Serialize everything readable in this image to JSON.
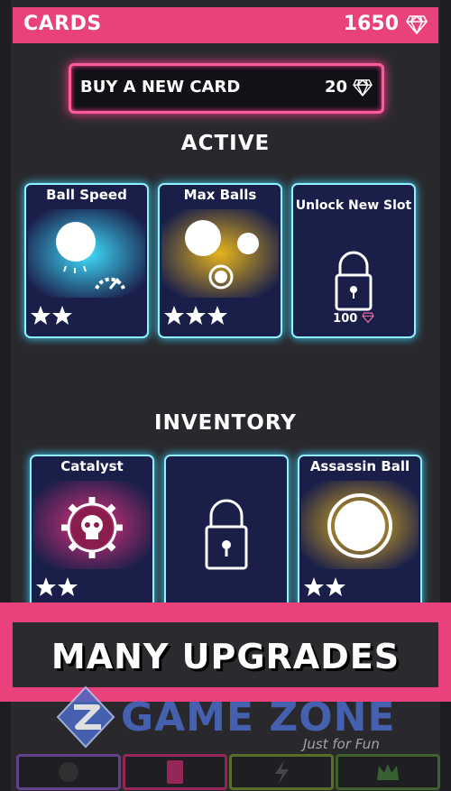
{
  "header": {
    "title": "CARDS",
    "gem_count": "1650"
  },
  "buy_button": {
    "label": "BUY A NEW CARD",
    "price": "20"
  },
  "sections": {
    "active": "ACTIVE",
    "inventory": "INVENTORY"
  },
  "active_cards": [
    {
      "name": "Ball Speed",
      "stars": 2,
      "art": "ball-speed-icon",
      "color": "#1ea7d6"
    },
    {
      "name": "Max Balls",
      "stars": 3,
      "art": "max-balls-icon",
      "color": "#d1a21a"
    }
  ],
  "unlock_slot": {
    "name": "Unlock New Slot",
    "price": "100"
  },
  "inventory_cards": [
    {
      "name": "Catalyst",
      "stars": 2,
      "art": "skull-gear-icon",
      "color": "#c2266b"
    },
    {
      "name": "",
      "art": "lock-icon"
    },
    {
      "name": "Assassin Ball",
      "stars": 2,
      "art": "ring-icon",
      "color": "#d1a21a"
    }
  ],
  "banner": {
    "text": "MANY UPGRADES"
  },
  "watermark": {
    "word": "GAME ZONE",
    "tagline": "Just for Fun"
  },
  "colors": {
    "accent": "#e8417c",
    "neon_cyan": "#8ff0ff",
    "card_bg": "#1a1f4a"
  }
}
